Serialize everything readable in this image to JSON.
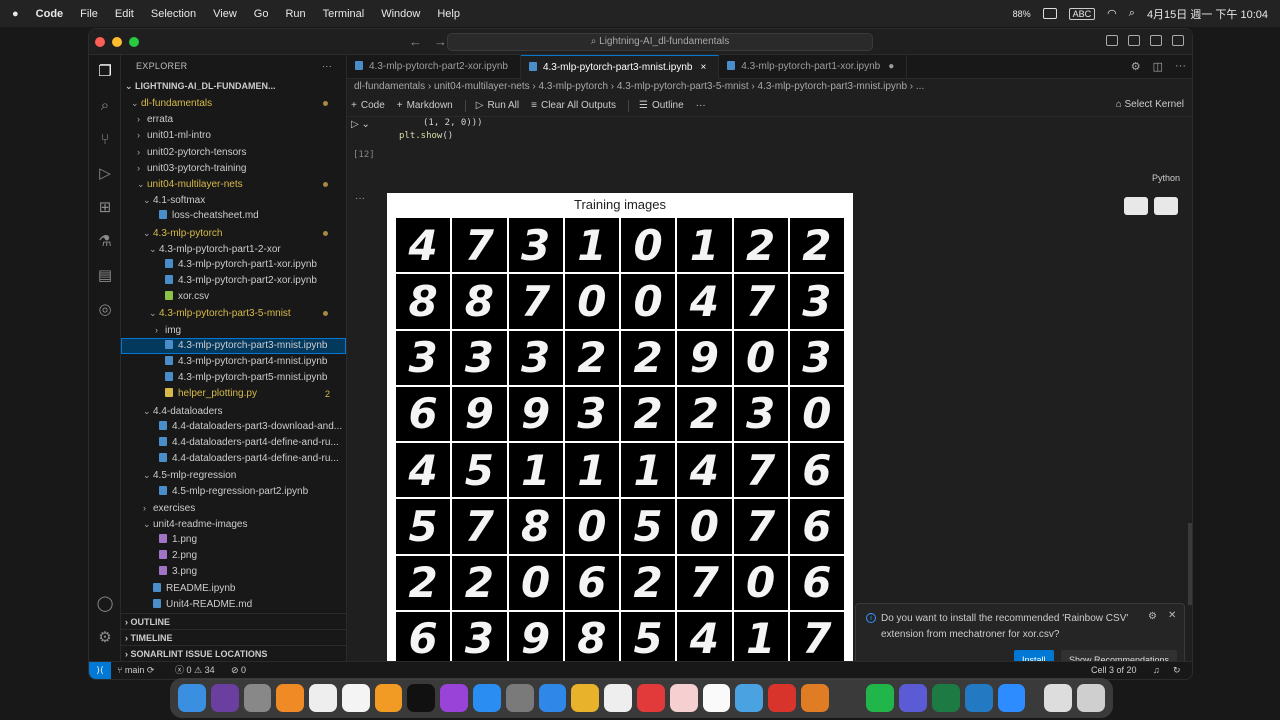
{
  "menubar": {
    "app": "Code",
    "items": [
      "File",
      "Edit",
      "Selection",
      "View",
      "Go",
      "Run",
      "Terminal",
      "Window",
      "Help"
    ],
    "mem": "88%",
    "input": "ABC",
    "clock": "4月15日 週一 下午 10:04"
  },
  "window": {
    "search": "Lightning-AI_dl-fundamentals"
  },
  "sidebar": {
    "title": "EXPLORER",
    "root": "LIGHTNING-AI_DL-FUNDAMEN...",
    "tree": [
      {
        "label": "dl-fundamentals",
        "depth": 0,
        "kind": "folder-open",
        "yellow": true,
        "dot": true
      },
      {
        "label": "errata",
        "depth": 1,
        "kind": "folder"
      },
      {
        "label": "unit01-ml-intro",
        "depth": 1,
        "kind": "folder"
      },
      {
        "label": "unit02-pytorch-tensors",
        "depth": 1,
        "kind": "folder"
      },
      {
        "label": "unit03-pytorch-training",
        "depth": 1,
        "kind": "folder"
      },
      {
        "label": "unit04-multilayer-nets",
        "depth": 1,
        "kind": "folder-open",
        "yellow": true,
        "dot": true
      },
      {
        "label": "4.1-softmax",
        "depth": 2,
        "kind": "folder-open"
      },
      {
        "label": "loss-cheatsheet.md",
        "depth": 3,
        "kind": "file"
      },
      {
        "label": "4.3-mlp-pytorch",
        "depth": 2,
        "kind": "folder-open",
        "yellow": true,
        "dot": true
      },
      {
        "label": "4.3-mlp-pytorch-part1-2-xor",
        "depth": 3,
        "kind": "folder-open"
      },
      {
        "label": "4.3-mlp-pytorch-part1-xor.ipynb",
        "depth": 4,
        "kind": "file"
      },
      {
        "label": "4.3-mlp-pytorch-part2-xor.ipynb",
        "depth": 4,
        "kind": "file"
      },
      {
        "label": "xor.csv",
        "depth": 4,
        "kind": "csv"
      },
      {
        "label": "4.3-mlp-pytorch-part3-5-mnist",
        "depth": 3,
        "kind": "folder-open",
        "yellow": true,
        "dot": true
      },
      {
        "label": "img",
        "depth": 4,
        "kind": "folder"
      },
      {
        "label": "4.3-mlp-pytorch-part3-mnist.ipynb",
        "depth": 4,
        "kind": "file",
        "selected": true
      },
      {
        "label": "4.3-mlp-pytorch-part4-mnist.ipynb",
        "depth": 4,
        "kind": "file"
      },
      {
        "label": "4.3-mlp-pytorch-part5-mnist.ipynb",
        "depth": 4,
        "kind": "file"
      },
      {
        "label": "helper_plotting.py",
        "depth": 4,
        "kind": "py",
        "yellow": true,
        "badge": "2"
      },
      {
        "label": "4.4-dataloaders",
        "depth": 2,
        "kind": "folder-open"
      },
      {
        "label": "4.4-dataloaders-part3-download-and...",
        "depth": 3,
        "kind": "file"
      },
      {
        "label": "4.4-dataloaders-part4-define-and-ru...",
        "depth": 3,
        "kind": "file"
      },
      {
        "label": "4.4-dataloaders-part4-define-and-ru...",
        "depth": 3,
        "kind": "file"
      },
      {
        "label": "4.5-mlp-regression",
        "depth": 2,
        "kind": "folder-open"
      },
      {
        "label": "4.5-mlp-regression-part2.ipynb",
        "depth": 3,
        "kind": "file"
      },
      {
        "label": "exercises",
        "depth": 2,
        "kind": "folder"
      },
      {
        "label": "unit4-readme-images",
        "depth": 2,
        "kind": "folder-open"
      },
      {
        "label": "1.png",
        "depth": 3,
        "kind": "img"
      },
      {
        "label": "2.png",
        "depth": 3,
        "kind": "img"
      },
      {
        "label": "3.png",
        "depth": 3,
        "kind": "img"
      },
      {
        "label": "README.ipynb",
        "depth": 2,
        "kind": "file"
      },
      {
        "label": "Unit4-README.md",
        "depth": 2,
        "kind": "file"
      }
    ],
    "sections": [
      "OUTLINE",
      "TIMELINE",
      "SONARLINT ISSUE LOCATIONS"
    ]
  },
  "tabs": [
    {
      "label": "4.3-mlp-pytorch-part2-xor.ipynb",
      "active": false
    },
    {
      "label": "4.3-mlp-pytorch-part3-mnist.ipynb",
      "active": true
    },
    {
      "label": "4.3-mlp-pytorch-part1-xor.ipynb",
      "active": false
    }
  ],
  "breadcrumb": [
    "dl-fundamentals",
    "unit04-multilayer-nets",
    "4.3-mlp-pytorch",
    "4.3-mlp-pytorch-part3-5-mnist",
    "4.3-mlp-pytorch-part3-mnist.ipynb",
    "..."
  ],
  "toolbar": {
    "code": "Code",
    "markdown": "Markdown",
    "run_all": "Run All",
    "clear": "Clear All Outputs",
    "outline": "Outline",
    "kernel": "Select Kernel"
  },
  "cell": {
    "line1": "(1, 2, 0)))",
    "line2_fn": "plt.show",
    "line2_rest": "()",
    "exec_count": "[12]",
    "language": "Python"
  },
  "figure": {
    "title": "Training images",
    "digits": [
      "4",
      "7",
      "3",
      "1",
      "0",
      "1",
      "2",
      "2",
      "8",
      "8",
      "7",
      "0",
      "0",
      "4",
      "7",
      "3",
      "3",
      "3",
      "3",
      "2",
      "2",
      "9",
      "0",
      "3",
      "6",
      "9",
      "9",
      "3",
      "2",
      "2",
      "3",
      "0",
      "4",
      "5",
      "1",
      "1",
      "1",
      "4",
      "7",
      "6",
      "5",
      "7",
      "8",
      "0",
      "5",
      "0",
      "7",
      "6",
      "2",
      "2",
      "0",
      "6",
      "2",
      "7",
      "0",
      "6",
      "6",
      "3",
      "9",
      "8",
      "5",
      "4",
      "1",
      "7"
    ]
  },
  "notification": {
    "message": "Do you want to install the recommended 'Rainbow CSV' extension from mechatroner for xor.csv?",
    "install": "Install",
    "recommend": "Show Recommendations"
  },
  "statusbar": {
    "branch": "main",
    "errors": "0",
    "warnings": "34",
    "ports": "0",
    "cell": "Cell 3 of 20"
  },
  "colors": {
    "accent": "#0078d4",
    "selection": "#04395e",
    "modified": "#d7ba4a"
  }
}
